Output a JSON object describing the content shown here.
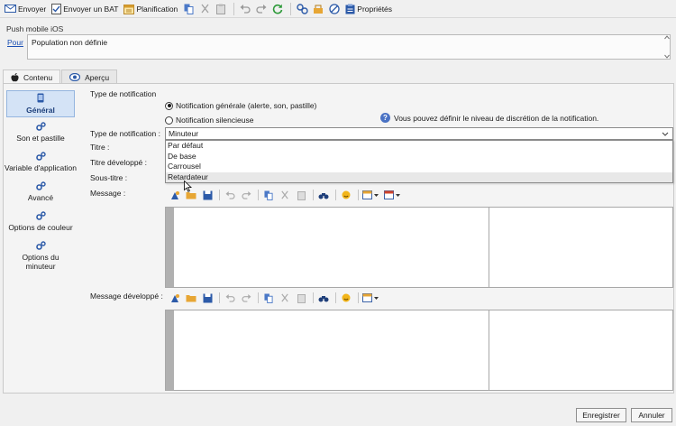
{
  "toolbar": {
    "send": "Envoyer",
    "send_proof": "Envoyer un BAT",
    "schedule": "Planification",
    "properties": "Propriétés"
  },
  "header": {
    "title": "Push mobile iOS",
    "pour_link": "Pour",
    "population": "Population non définie"
  },
  "tabs": [
    {
      "label": "Contenu",
      "icon": "apple-icon"
    },
    {
      "label": "Aperçu",
      "icon": "eye-icon"
    }
  ],
  "sidebar": {
    "items": [
      {
        "label": "Général",
        "icon": "mobile-icon"
      },
      {
        "label": "Son et pastille",
        "icon": "gears-icon"
      },
      {
        "label": "Variable d'application",
        "icon": "gears-icon"
      },
      {
        "label": "Avancé",
        "icon": "gears-icon"
      },
      {
        "label": "Options de couleur",
        "icon": "gears-icon"
      },
      {
        "label": "Options du minuteur",
        "icon": "gears-icon"
      }
    ]
  },
  "form": {
    "section_title": "Type de notification",
    "radio_general": "Notification générale (alerte, son, pastille)",
    "radio_silent": "Notification silencieuse",
    "info": "Vous pouvez définir le niveau de discrétion de la notification.",
    "type_label": "Type de notification :",
    "type_value": "Minuteur",
    "type_options": [
      "Par défaut",
      "De base",
      "Carrousel",
      "Retardateur"
    ],
    "title_label": "Titre :",
    "expanded_title_label": "Titre développé :",
    "subtitle_label": "Sous-titre :",
    "message_label": "Message :",
    "expanded_message_label": "Message développé :"
  },
  "footer": {
    "save": "Enregistrer",
    "cancel": "Annuler"
  },
  "colors": {
    "accent": "#1a4fb4",
    "selected_bg": "#d4e3f6",
    "refresh_green": "#2e9a3a"
  }
}
